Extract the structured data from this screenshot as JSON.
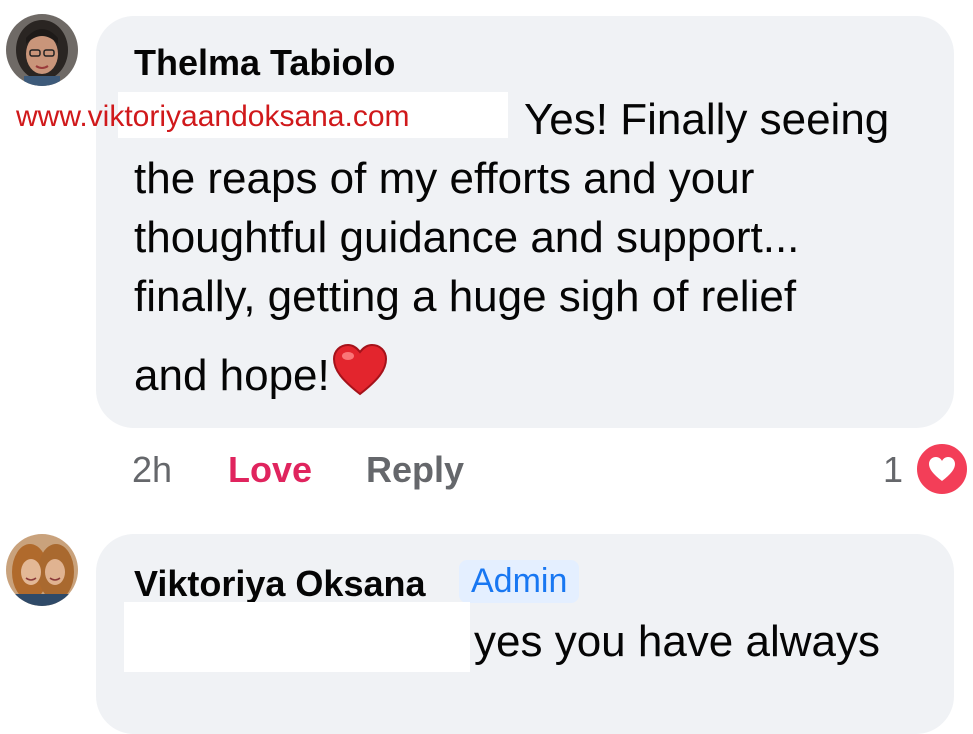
{
  "watermark": "www.viktoriyaandoksana.com",
  "comments": [
    {
      "author": "Thelma Tabiolo",
      "lines": [
        "Yes! Finally seeing",
        "the reaps of my efforts and your",
        "thoughtful guidance and support...",
        "finally, getting a huge sigh of relief",
        "and hope!"
      ],
      "emoji": "red-heart-icon",
      "time": "2h",
      "love_label": "Love",
      "reply_label": "Reply",
      "reaction_count": "1"
    },
    {
      "author": "Viktoriya Oksana",
      "badge": "Admin",
      "lines": [
        "yes you have always"
      ]
    }
  ],
  "colors": {
    "bubble": "#f0f2f5",
    "love_active": "#e0245e",
    "meta_gray": "#65676b",
    "admin_badge_bg": "#e4efff",
    "admin_badge_text": "#1877f2",
    "watermark": "#d0191b",
    "reaction_heart": "#f33e58"
  }
}
